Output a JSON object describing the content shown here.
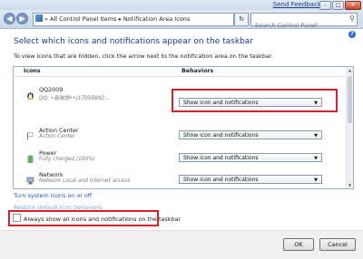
{
  "header": {
    "feedback_link": "Send Feedback",
    "breadcrumb": "» All Control Panel Items ▸ Notification Area Icons",
    "search_placeholder": "Search Control Panel"
  },
  "page": {
    "heading": "Select which icons and notifications appear on the taskbar",
    "instructions": "To view icons that are hidden, click the arrow next to the notification area on the taskbar.",
    "col_icons": "Icons",
    "col_behaviors": "Behaviors"
  },
  "rows": [
    {
      "name": "QQ2009",
      "sub": "QQ: •我微想••(17058892...",
      "behavior": "Show icon and notifications"
    },
    {
      "name": "Action Center",
      "sub": "Action Center",
      "behavior": "Show icon and notifications"
    },
    {
      "name": "Power",
      "sub": "Fully charged (100%)",
      "behavior": "Show icon and notifications"
    },
    {
      "name": "Network",
      "sub": "Network Local and Internet access",
      "behavior": "Show icon and notifications"
    }
  ],
  "links": {
    "turn_system_icons": "Turn system icons on or off",
    "restore_default": "Restore default icon behaviors"
  },
  "checkbox": {
    "label": "Always show all icons and notifications on the taskbar",
    "checked": false
  },
  "buttons": {
    "ok": "OK",
    "cancel": "Cancel"
  },
  "colors": {
    "highlight": "#d81f2a",
    "heading": "#1e3a8a",
    "link": "#1f55b5"
  }
}
